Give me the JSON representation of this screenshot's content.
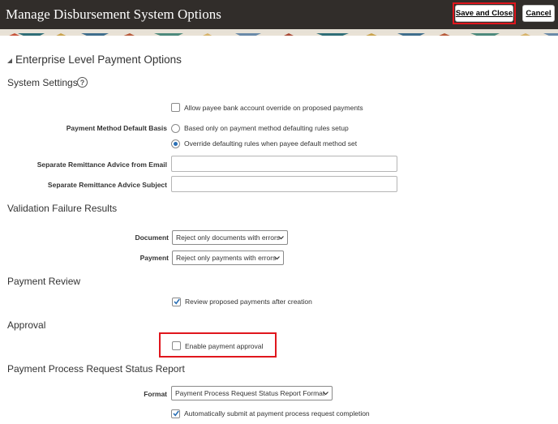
{
  "header": {
    "title": "Manage Disbursement System Options",
    "save_close_label": "Save and Close",
    "cancel_label": "Cancel"
  },
  "region": {
    "title": "Enterprise Level Payment Options"
  },
  "system_settings": {
    "title": "System Settings",
    "allow_override_label": "Allow payee bank account override on proposed payments",
    "allow_override_checked": false,
    "payment_method_label": "Payment Method Default Basis",
    "payment_method_options": [
      {
        "label": "Based only on payment method defaulting rules setup",
        "selected": false
      },
      {
        "label": "Override defaulting rules when payee default method set",
        "selected": true
      }
    ],
    "remittance_email_label": "Separate Remittance Advice from Email",
    "remittance_email_value": "",
    "remittance_subject_label": "Separate Remittance Advice Subject",
    "remittance_subject_value": ""
  },
  "validation": {
    "title": "Validation Failure Results",
    "document_label": "Document",
    "document_value": "Reject only documents with errors",
    "payment_label": "Payment",
    "payment_value": "Reject only payments with errors"
  },
  "payment_review": {
    "title": "Payment Review",
    "review_label": "Review proposed payments after creation",
    "review_checked": true
  },
  "approval": {
    "title": "Approval",
    "enable_label": "Enable payment approval",
    "enable_checked": false
  },
  "status_report": {
    "title": "Payment Process Request Status Report",
    "format_label": "Format",
    "format_value": "Payment Process Request Status Report Format",
    "auto_submit_label": "Automatically submit at payment process request completion",
    "auto_submit_checked": true
  },
  "colors": {
    "header_bg": "#312d2a",
    "highlight": "#e0161d",
    "accent": "#2a6fb5"
  }
}
